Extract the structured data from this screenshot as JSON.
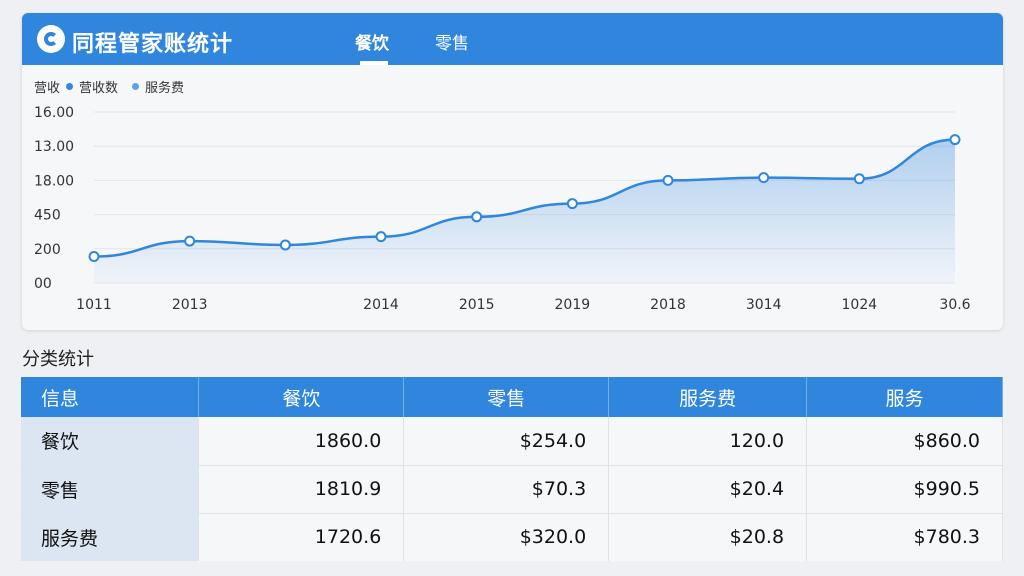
{
  "header": {
    "title": "同程管家账统计",
    "tabs": [
      {
        "label": "餐饮",
        "active": true
      },
      {
        "label": "零售",
        "active": false
      }
    ],
    "accent": "#2f86dc"
  },
  "legend": {
    "prefix": "营收",
    "items": [
      {
        "label": "营收数",
        "color": "#2f86dc"
      },
      {
        "label": "服务费",
        "color": "#5aa2e6"
      }
    ]
  },
  "chart_data": {
    "type": "area",
    "x": [
      "1011",
      "2013",
      "",
      "2014",
      "2015",
      "2019",
      "2018",
      "3014",
      "1024",
      "30.6"
    ],
    "y_tick_labels": [
      "16.00",
      "13.00",
      "18.00",
      "450",
      "200",
      "00"
    ],
    "series": [
      {
        "values": [
          240,
          380,
          345,
          420,
          600,
          720,
          930,
          955,
          945,
          1300
        ]
      }
    ],
    "ylim": [
      0,
      1550
    ],
    "grid": true,
    "legend": "top-left",
    "color": "#2f86dc"
  },
  "table": {
    "title": "分类统计",
    "columns": [
      "信息",
      "餐饮",
      "零售",
      "服务费",
      "服务"
    ],
    "rows": [
      [
        "餐饮",
        "1860.0",
        "$254.0",
        "120.0",
        "$860.0"
      ],
      [
        "零售",
        "1810.9",
        "$70.3",
        "$20.4",
        "$990.5"
      ],
      [
        "服务费",
        "1720.6",
        "$320.0",
        "$20.8",
        "$780.3"
      ]
    ]
  }
}
